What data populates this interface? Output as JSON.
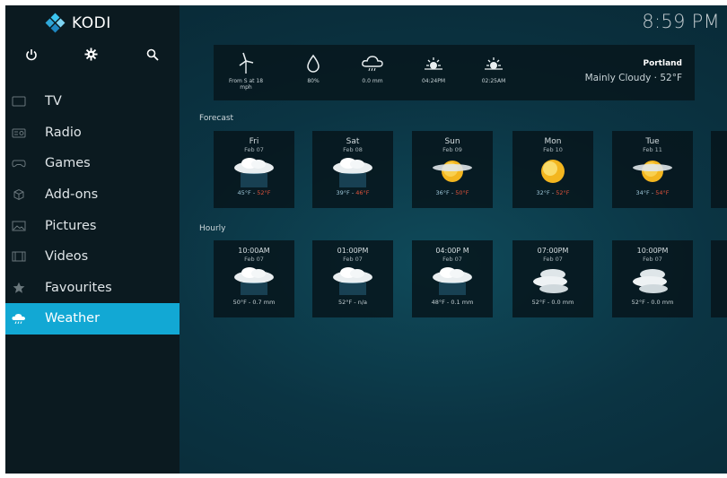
{
  "app": {
    "brand": "KODI",
    "clock": "8:59 PM"
  },
  "sidebar": {
    "top_icons": [
      "power-icon",
      "settings-icon",
      "search-icon"
    ],
    "items": [
      {
        "label": "TV",
        "icon": "tv-icon"
      },
      {
        "label": "Radio",
        "icon": "radio-icon"
      },
      {
        "label": "Games",
        "icon": "gamepad-icon"
      },
      {
        "label": "Add-ons",
        "icon": "addons-icon"
      },
      {
        "label": "Pictures",
        "icon": "pictures-icon"
      },
      {
        "label": "Videos",
        "icon": "videos-icon"
      },
      {
        "label": "Favourites",
        "icon": "star-icon"
      },
      {
        "label": "Weather",
        "icon": "weather-icon",
        "active": true
      }
    ]
  },
  "current": {
    "wind": "From S at 18 mph",
    "humidity": "80%",
    "precip": "0.0 mm",
    "sunrise": "04:24PM",
    "sunset": "02:25AM",
    "location": "Portland",
    "condition": "Mainly Cloudy · 52°F"
  },
  "forecast": {
    "title": "Forecast",
    "days": [
      {
        "day": "Fri",
        "date": "Feb 07",
        "low": "45°F",
        "high": "52°F",
        "icon": "rain-cloud-icon"
      },
      {
        "day": "Sat",
        "date": "Feb 08",
        "low": "39°F",
        "high": "46°F",
        "icon": "rain-cloud-icon"
      },
      {
        "day": "Sun",
        "date": "Feb 09",
        "low": "36°F",
        "high": "50°F",
        "icon": "sun-cloud-icon"
      },
      {
        "day": "Mon",
        "date": "Feb 10",
        "low": "32°F",
        "high": "52°F",
        "icon": "sun-icon"
      },
      {
        "day": "Tue",
        "date": "Feb 11",
        "low": "34°F",
        "high": "54°F",
        "icon": "sun-cloud-icon"
      }
    ]
  },
  "hourly": {
    "title": "Hourly",
    "hours": [
      {
        "time": "10:00AM",
        "date": "Feb 07",
        "info": "50°F - 0.7 mm",
        "icon": "rain-cloud-icon"
      },
      {
        "time": "01:00PM",
        "date": "Feb 07",
        "info": "52°F - n/a",
        "icon": "rain-cloud-icon"
      },
      {
        "time": "04:00P M",
        "date": "Feb 07",
        "info": "48°F - 0.1 mm",
        "icon": "rain-cloud-icon"
      },
      {
        "time": "07:00PM",
        "date": "Feb 07",
        "info": "52°F - 0.0 mm",
        "icon": "clouds-icon"
      },
      {
        "time": "10:00PM",
        "date": "Feb 07",
        "info": "52°F - 0.0 mm",
        "icon": "clouds-icon"
      }
    ]
  },
  "colors": {
    "accent": "#12a8d4",
    "sidebar": "#0b1a20",
    "high_temp": "#e0523a",
    "low_temp": "#9ec7d9"
  }
}
